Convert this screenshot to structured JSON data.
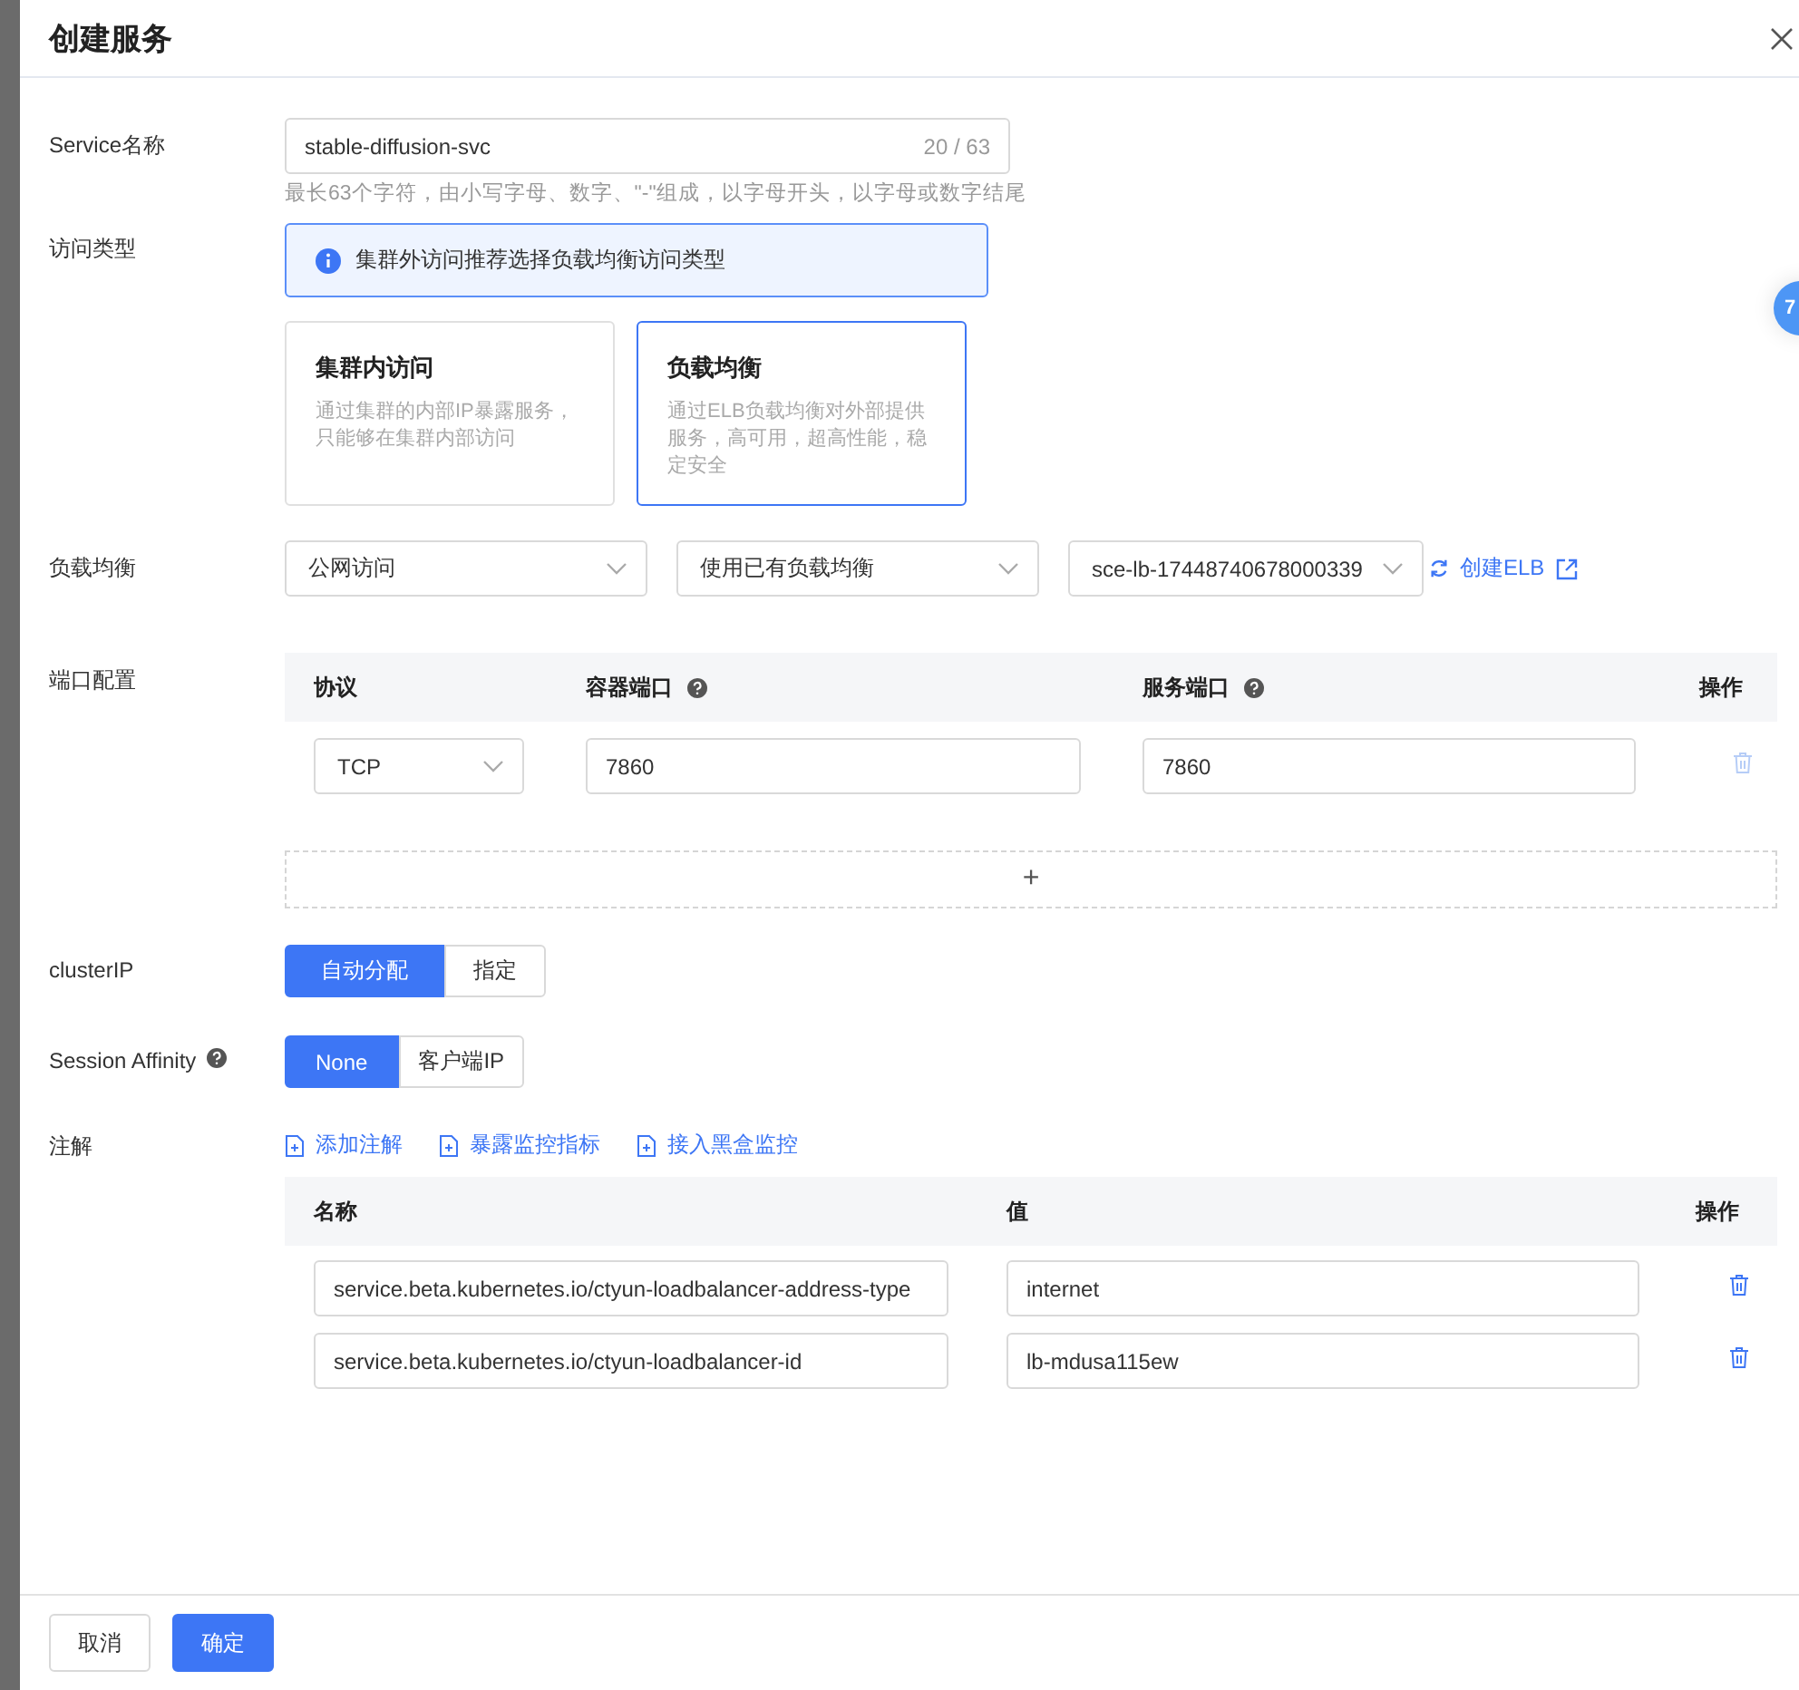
{
  "dialog": {
    "title": "创建服务",
    "floating_badge": "7"
  },
  "service_name": {
    "label": "Service名称",
    "value": "stable-diffusion-svc",
    "counter": "20 / 63",
    "hint": "最长63个字符，由小写字母、数字、\"-\"组成，以字母开头，以字母或数字结尾"
  },
  "access_type": {
    "label": "访问类型",
    "notice": "集群外访问推荐选择负载均衡访问类型",
    "options": [
      {
        "title": "集群内访问",
        "description": "通过集群的内部IP暴露服务，只能够在集群内部访问",
        "selected": false
      },
      {
        "title": "负载均衡",
        "description": "通过ELB负载均衡对外部提供服务，高可用，超高性能，稳定安全",
        "selected": true
      }
    ]
  },
  "load_balancer": {
    "label": "负载均衡",
    "selects": [
      "公网访问",
      "使用已有负载均衡",
      "sce-lb-17448740678000339"
    ],
    "create_link": "创建ELB"
  },
  "ports": {
    "label": "端口配置",
    "columns": [
      "协议",
      "容器端口",
      "服务端口",
      "操作"
    ],
    "rows": [
      {
        "protocol": "TCP",
        "container_port": "7860",
        "service_port": "7860",
        "disabled": true
      }
    ],
    "add_symbol": "+"
  },
  "cluster_ip": {
    "label": "clusterIP",
    "options": [
      {
        "label": "自动分配",
        "selected": true
      },
      {
        "label": "指定",
        "selected": false
      }
    ]
  },
  "session_affinity": {
    "label": "Session Affinity",
    "options": [
      {
        "label": "None",
        "selected": true
      },
      {
        "label": "客户端IP",
        "selected": false
      }
    ]
  },
  "annotations": {
    "label": "注解",
    "actions": [
      "添加注解",
      "暴露监控指标",
      "接入黑盒监控"
    ],
    "columns": [
      "名称",
      "值",
      "操作"
    ],
    "rows": [
      {
        "name": "service.beta.kubernetes.io/ctyun-loadbalancer-address-type",
        "value": "internet",
        "disabled": false
      },
      {
        "name": "service.beta.kubernetes.io/ctyun-loadbalancer-id",
        "value": "lb-mdusa115ew",
        "disabled": false
      }
    ]
  },
  "footer": {
    "buttons": [
      {
        "label": "取消",
        "kind": "secondary"
      },
      {
        "label": "确定",
        "kind": "primary"
      }
    ]
  }
}
